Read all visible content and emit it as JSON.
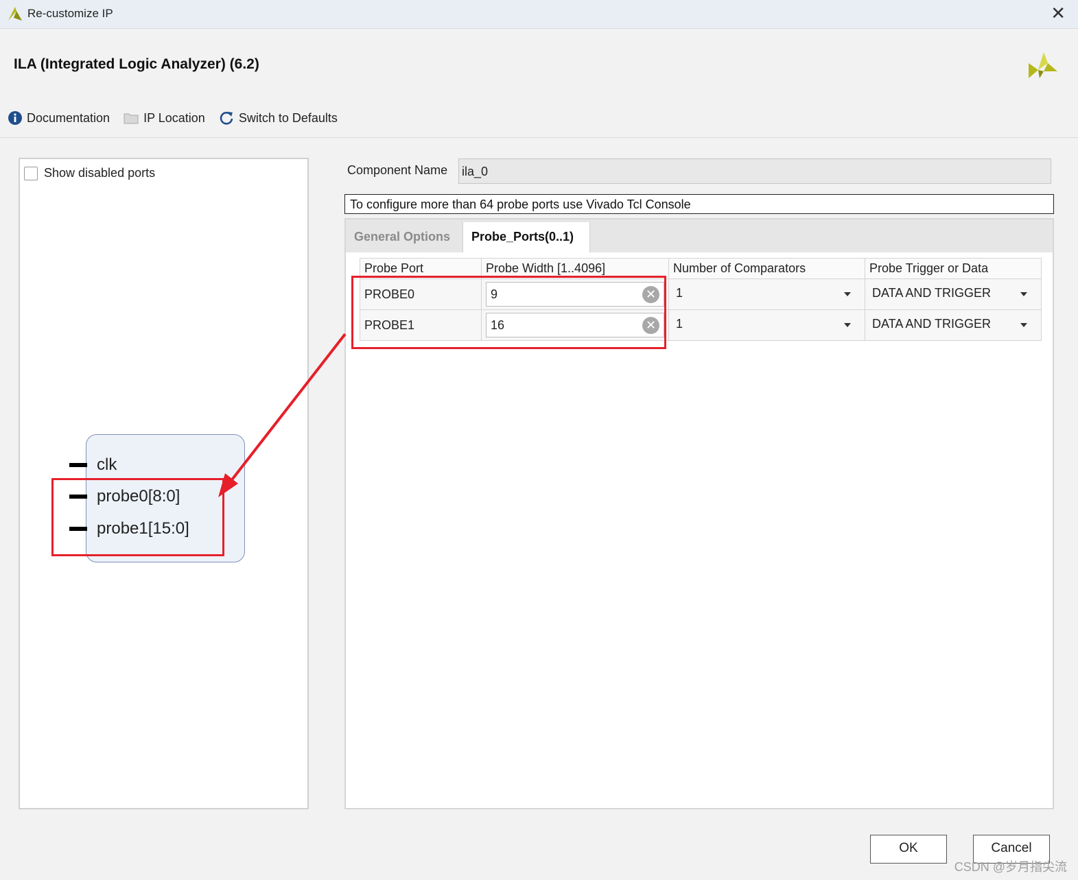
{
  "window": {
    "title": "Re-customize IP",
    "close_glyph": "✕"
  },
  "header": {
    "title": "ILA (Integrated Logic Analyzer) (6.2)"
  },
  "toolbar": {
    "documentation": "Documentation",
    "ip_location": "IP Location",
    "switch_defaults": "Switch to Defaults"
  },
  "left_panel": {
    "show_disabled_label": "Show disabled ports",
    "ports": [
      "clk",
      "probe0[8:0]",
      "probe1[15:0]"
    ]
  },
  "component": {
    "label": "Component Name",
    "value": "ila_0"
  },
  "note": "To configure more than 64 probe ports use Vivado Tcl Console",
  "tabs": [
    {
      "label": "General Options",
      "active": false
    },
    {
      "label": "Probe_Ports(0..1)",
      "active": true
    }
  ],
  "table": {
    "headers": [
      "Probe Port",
      "Probe Width [1..4096]",
      "Number of Comparators",
      "Probe Trigger or Data"
    ],
    "rows": [
      {
        "port": "PROBE0",
        "width": "9",
        "comparators": "1",
        "trigger": "DATA AND TRIGGER"
      },
      {
        "port": "PROBE1",
        "width": "16",
        "comparators": "1",
        "trigger": "DATA AND TRIGGER"
      }
    ]
  },
  "buttons": {
    "ok": "OK",
    "cancel": "Cancel"
  },
  "watermark": "CSDN @岁月指尖流",
  "colors": {
    "highlight": "#e5202a",
    "accent_logo": "#b5b81a",
    "info_icon": "#1f4e8c"
  }
}
